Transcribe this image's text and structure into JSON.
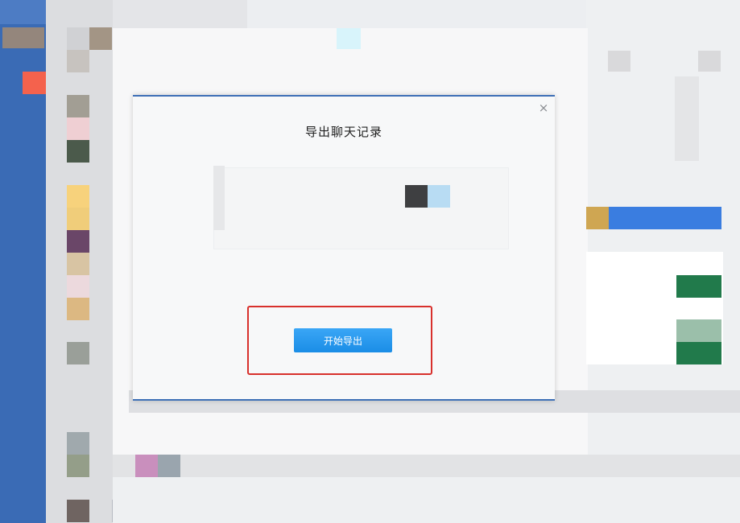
{
  "dialog": {
    "title": "导出聊天记录",
    "close_glyph": "×",
    "start_export_label": "开始导出"
  },
  "colors": {
    "accent_blue": "#1a8de6",
    "dialog_border": "#3d6fb6",
    "highlight_red": "#d8302c",
    "left_rail": "#3a6bb5"
  },
  "icons": {
    "close": "close-icon"
  }
}
